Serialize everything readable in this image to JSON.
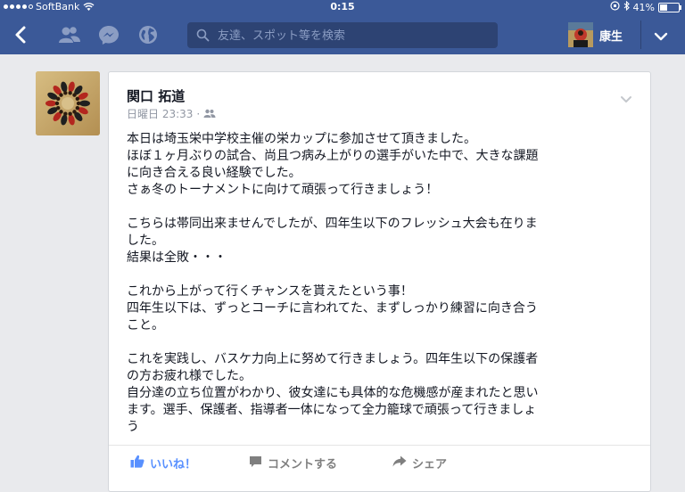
{
  "status_bar": {
    "carrier": "SoftBank",
    "time": "0:15",
    "battery_text": "41%",
    "battery_level": 0.41,
    "signal_bars": 4
  },
  "nav": {
    "search_placeholder": "友達、スポット等を検索",
    "profile_name": "康生",
    "colors": {
      "bar": "#3b5998",
      "search_bg": "#2d4373"
    }
  },
  "post": {
    "author": "関口 拓道",
    "timestamp": "日曜日 23:33",
    "separator": "·",
    "audience_icon": "friends-icon",
    "text": "本日は埼玉栄中学校主催の栄カップに参加させて頂きました。\nほぼ１ヶ月ぶりの試合、尚且つ病み上がりの選手がいた中で、大きな課題\nに向き合える良い経験でした。\nさぁ冬のトーナメントに向けて頑張って行きましょう！\n\nこちらは帯同出来ませんでしたが、四年生以下のフレッシュ大会も在りま\nした。\n結果は全敗・・・\n\nこれから上がって行くチャンスを貰えたという事！\n四年生以下は、ずっとコーチに言われてた、まずしっかり練習に向き合う\nこと。\n\nこれを実践し、バスケ力向上に努めて行きましょう。四年生以下の保護者\nの方お疲れ様でした。\n自分達の立ち位置がわかり、彼女達にも具体的な危機感が産まれたと思い\nます。選手、保護者、指導者一体になって全力籠球で頑張って行きましょ\nう"
  },
  "actions": {
    "like": "いいね！",
    "comment": "コメントする",
    "share": "シェア",
    "like_color": "#5890ff"
  }
}
